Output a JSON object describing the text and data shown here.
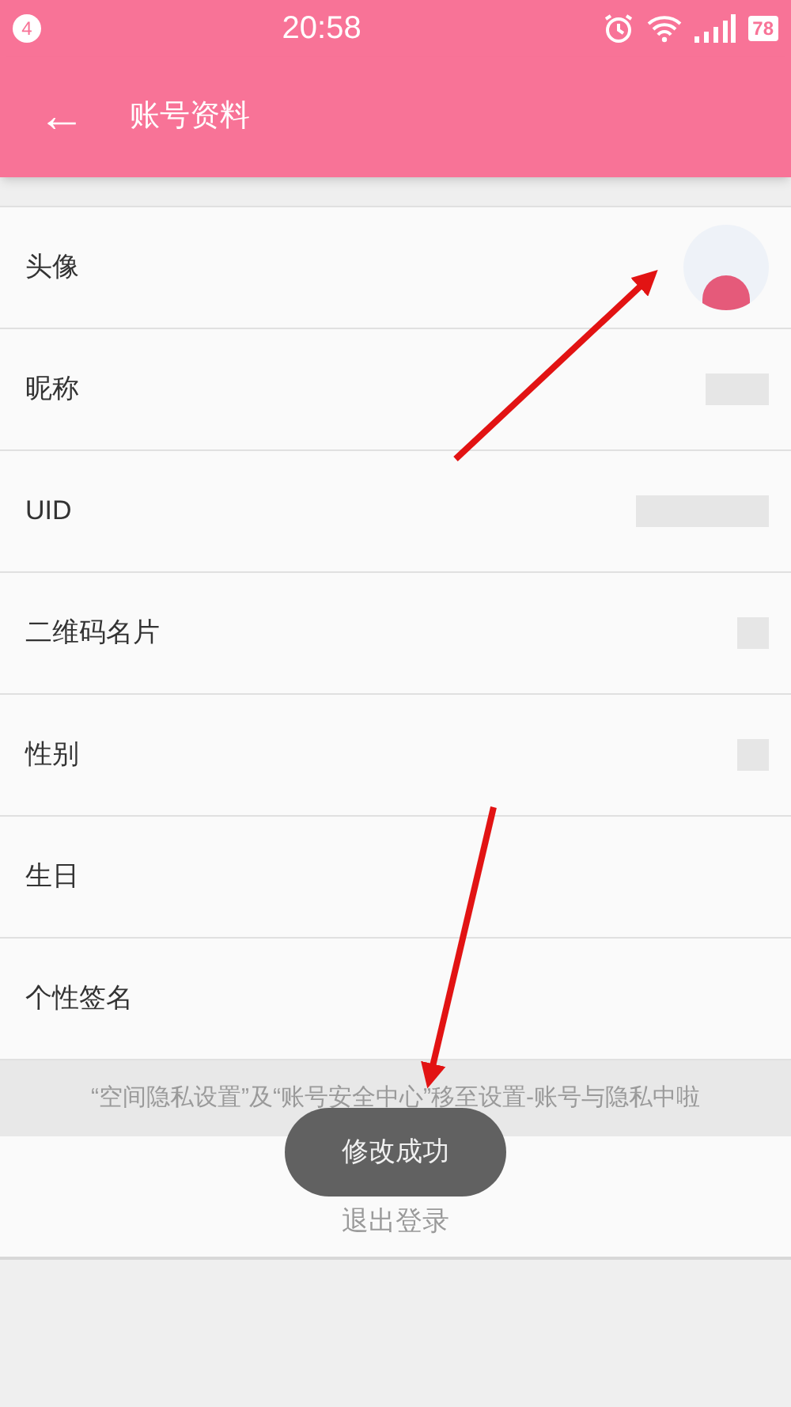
{
  "status_bar": {
    "notification_count": "4",
    "time": "20:58",
    "battery": "78"
  },
  "header": {
    "back_icon": "←",
    "title": "账号资料"
  },
  "rows": [
    {
      "label": "头像",
      "kind": "avatar"
    },
    {
      "label": "昵称",
      "kind": "redacted"
    },
    {
      "label": "UID",
      "kind": "redacted"
    },
    {
      "label": "二维码名片",
      "kind": "redacted"
    },
    {
      "label": "性别",
      "kind": "redacted"
    },
    {
      "label": "生日",
      "kind": "plain"
    },
    {
      "label": "个性签名",
      "kind": "plain"
    }
  ],
  "notice": "“空间隐私设置”及“账号安全中心”移至设置-账号与隐私中啦",
  "logout": "退出登录",
  "toast": "修改成功"
}
